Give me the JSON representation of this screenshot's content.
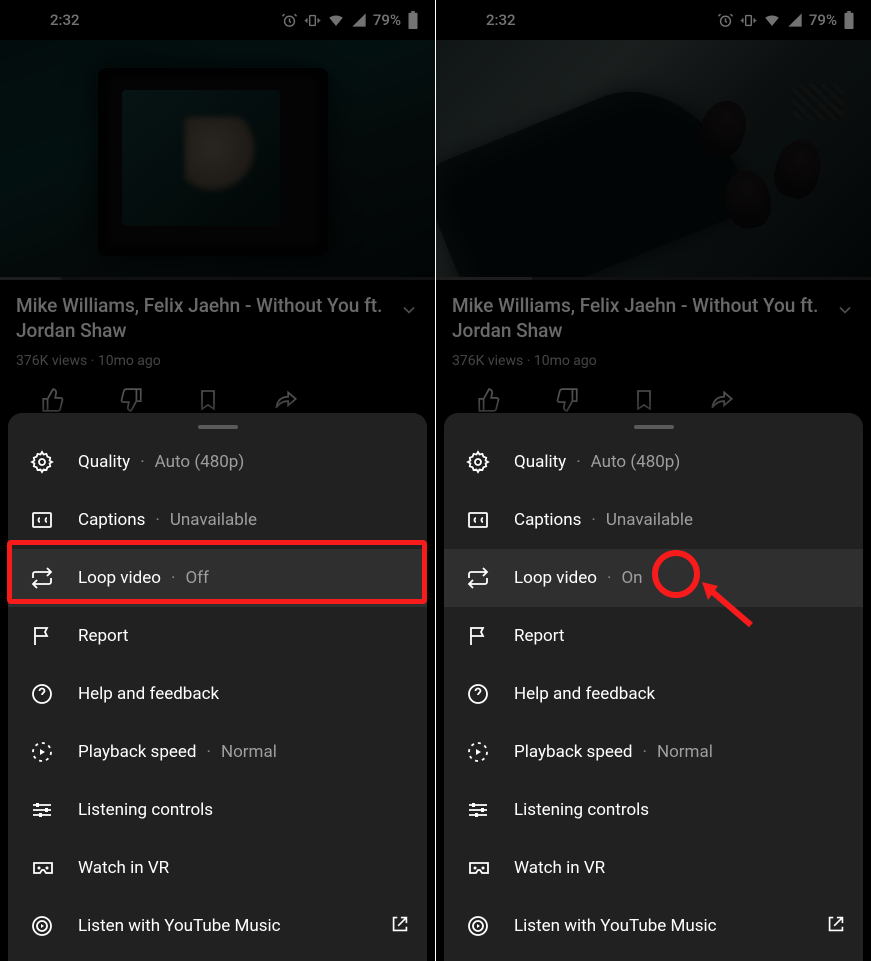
{
  "statusbar": {
    "time": "2:32",
    "battery": "79%"
  },
  "video": {
    "title": "Mike Williams, Felix Jaehn - Without You ft. Jordan Shaw",
    "views": "376K views",
    "age": "10mo ago"
  },
  "sheet": {
    "quality": {
      "label": "Quality",
      "value": "Auto (480p)"
    },
    "captions": {
      "label": "Captions",
      "value": "Unavailable"
    },
    "loop_off": {
      "label": "Loop video",
      "value": "Off"
    },
    "loop_on": {
      "label": "Loop video",
      "value": "On"
    },
    "report": {
      "label": "Report"
    },
    "help": {
      "label": "Help and feedback"
    },
    "speed": {
      "label": "Playback speed",
      "value": "Normal"
    },
    "listen": {
      "label": "Listening controls"
    },
    "vr": {
      "label": "Watch in VR"
    },
    "ytmusic": {
      "label": "Listen with YouTube Music"
    }
  }
}
